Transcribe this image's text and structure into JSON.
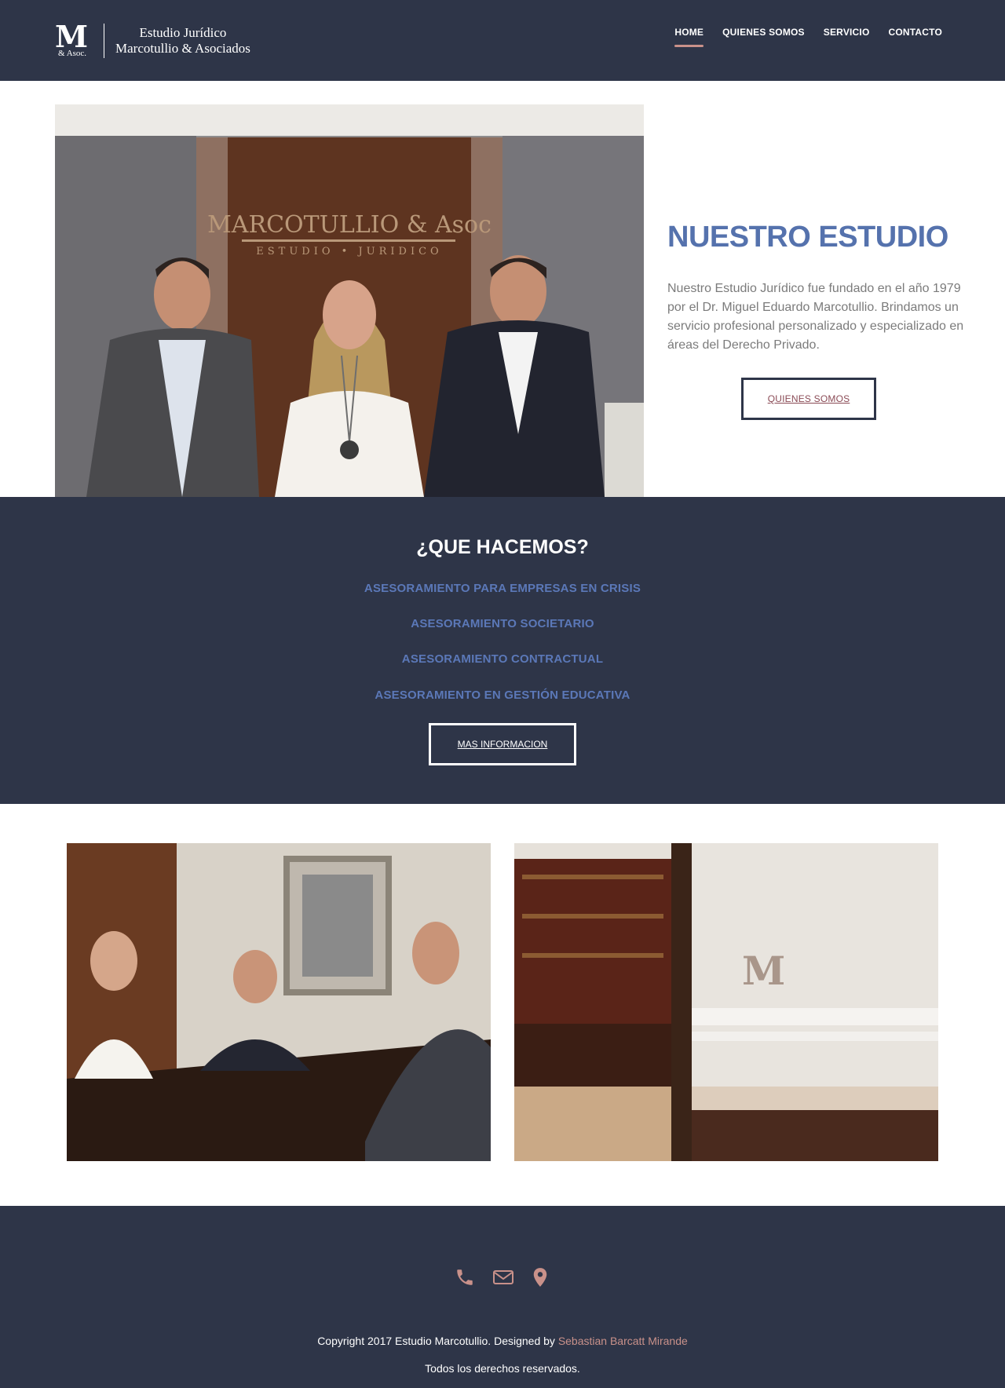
{
  "header": {
    "logo": {
      "mark": "M",
      "mark_sub": "& Asoc.",
      "line1": "Estudio Jurídico",
      "line2": "Marcotullio & Asociados"
    },
    "nav": [
      {
        "label": "HOME",
        "active": true
      },
      {
        "label": "QUIENES SOMOS",
        "active": false
      },
      {
        "label": "SERVICIO",
        "active": false
      },
      {
        "label": "CONTACTO",
        "active": false
      }
    ]
  },
  "hero": {
    "sign_line1": "MARCOTULLIO & Asoc",
    "sign_line2": "ESTUDIO • JURIDICO",
    "title": "NUESTRO ESTUDIO",
    "text": "Nuestro Estudio Jurídico fue fundado en el año 1979 por el Dr. Miguel Eduardo Marcotullio. Brindamos un servicio profesional personalizado y especializado en áreas del Derecho Privado.",
    "button": "QUIENES SOMOS"
  },
  "services": {
    "title": "¿QUE HACEMOS?",
    "items": [
      "ASESORAMIENTO PARA EMPRESAS EN CRISIS",
      "ASESORAMIENTO SOCIETARIO",
      "ASESORAMIENTO CONTRACTUAL",
      "ASESORAMIENTO EN GESTIÓN EDUCATIVA"
    ],
    "button": "MAS INFORMACION"
  },
  "footer": {
    "icons": [
      "phone-icon",
      "envelope-icon",
      "map-marker-icon"
    ],
    "copyright_text": "Copyright 2017 Estudio Marcotullio. Designed by ",
    "designer": "Sebastian Barcatt Mirande",
    "rights": "Todos los derechos reservados."
  },
  "colors": {
    "navy": "#2e3548",
    "accent_blue": "#5572ad",
    "accent_rose": "#c9918a",
    "text_gray": "#7b7b7b"
  }
}
